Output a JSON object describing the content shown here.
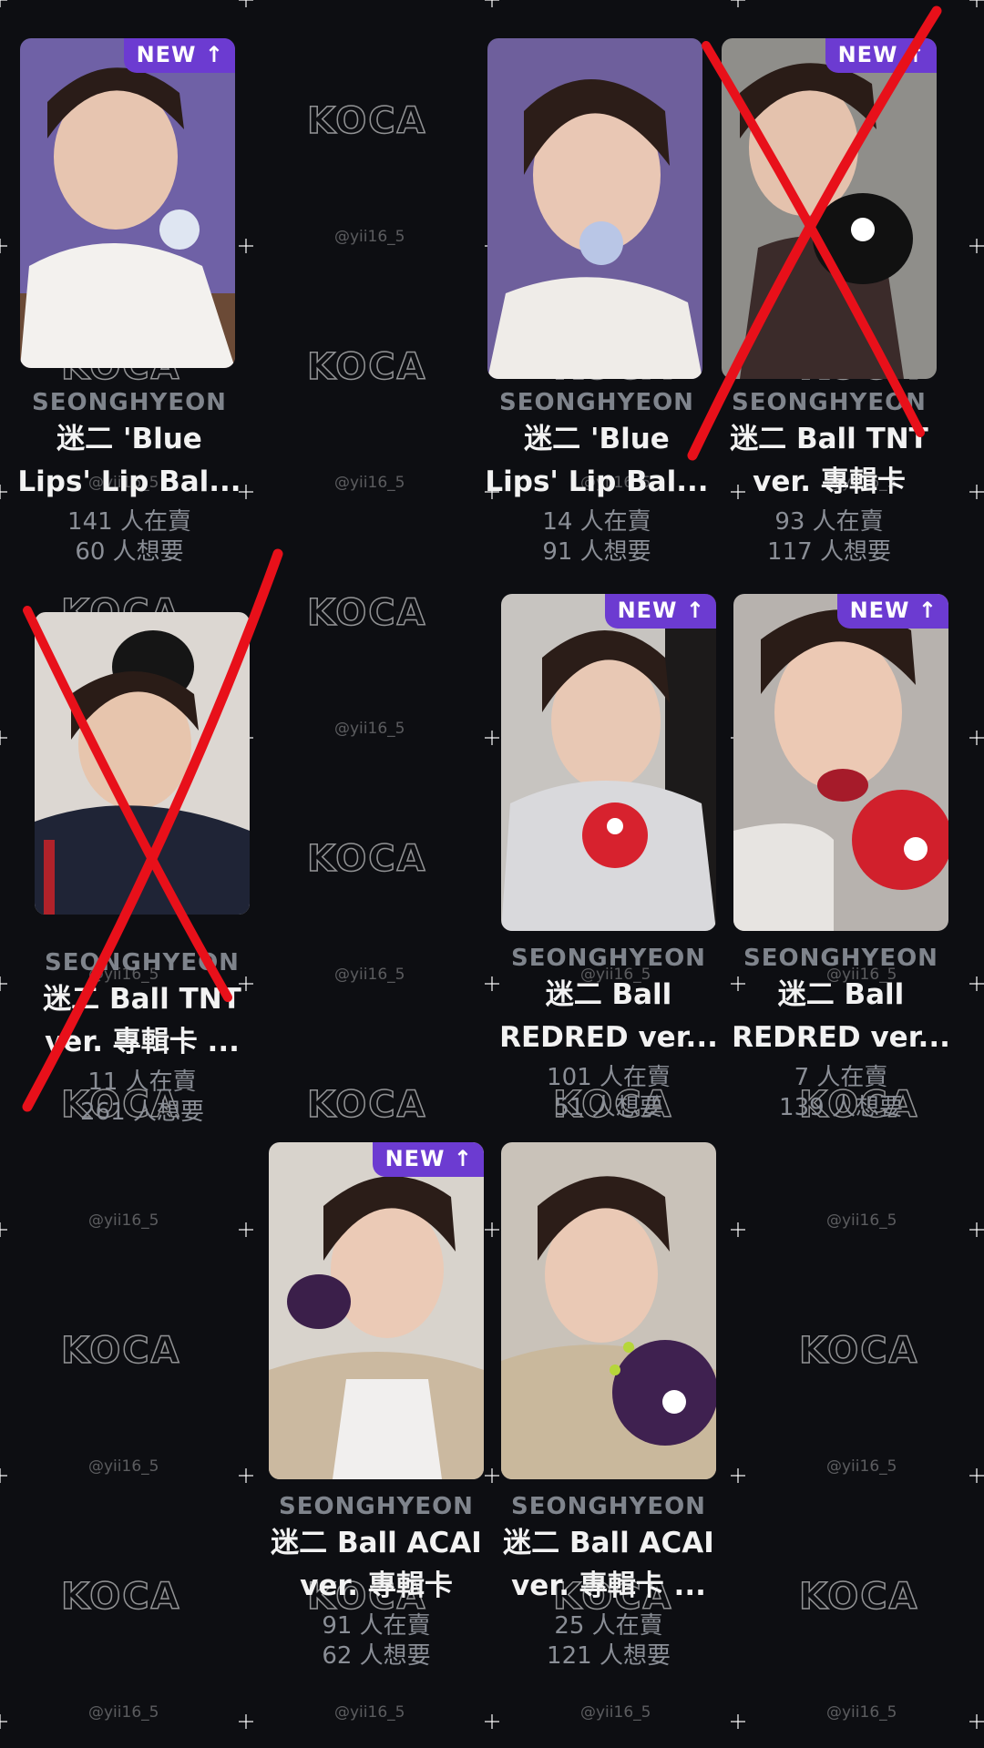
{
  "watermark": {
    "logo": "KOCA",
    "handle": "@yii16_5"
  },
  "cards": [
    {
      "member": "SEONGHYEON",
      "title_line1": "迷二 'Blue",
      "title_line2": "Lips' Lip Bal...",
      "selling": "141 人在賣",
      "wanting": "60 人想要",
      "badge": "NEW ↑",
      "crossed": false
    },
    {
      "member": "SEONGHYEON",
      "title_line1": "迷二 'Blue",
      "title_line2": "Lips' Lip Bal...",
      "selling": "14 人在賣",
      "wanting": "91 人想要",
      "badge": "",
      "crossed": false
    },
    {
      "member": "SEONGHYEON",
      "title_line1": "迷二 Ball TNT",
      "title_line2": "ver. 專輯卡",
      "selling": "93 人在賣",
      "wanting": "117 人想要",
      "badge": "NEW ↑",
      "crossed": true
    },
    {
      "member": "SEONGHYEON",
      "title_line1": "迷二 Ball TNT",
      "title_line2": "ver. 專輯卡 ...",
      "selling": "11 人在賣",
      "wanting": "261 人想要",
      "badge": "",
      "crossed": true
    },
    {
      "member": "SEONGHYEON",
      "title_line1": "迷二 Ball",
      "title_line2": "REDRED ver...",
      "selling": "101 人在賣",
      "wanting": "51 人想要",
      "badge": "NEW ↑",
      "crossed": false
    },
    {
      "member": "SEONGHYEON",
      "title_line1": "迷二 Ball",
      "title_line2": "REDRED ver...",
      "selling": "7 人在賣",
      "wanting": "139 人想要",
      "badge": "NEW ↑",
      "crossed": false
    },
    {
      "member": "SEONGHYEON",
      "title_line1": "迷二 Ball ACAI",
      "title_line2": "ver. 專輯卡",
      "selling": "91 人在賣",
      "wanting": "62 人想要",
      "badge": "NEW ↑",
      "crossed": false
    },
    {
      "member": "SEONGHYEON",
      "title_line1": "迷二 Ball ACAI",
      "title_line2": "ver. 專輯卡 ...",
      "selling": "25 人在賣",
      "wanting": "121 人想要",
      "badge": "",
      "crossed": false
    }
  ],
  "colors": {
    "background": "#0d0e12",
    "badge": "#6c3bd1",
    "cross": "#e8101a",
    "member": "#7f848c",
    "stat": "#8a8e96"
  }
}
